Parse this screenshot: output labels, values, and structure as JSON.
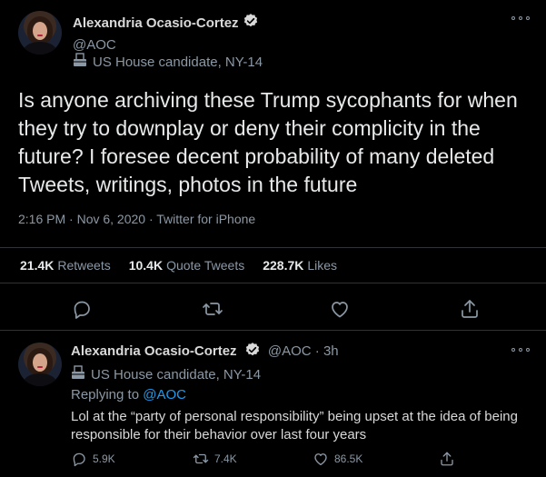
{
  "main": {
    "author_name": "Alexandria Ocasio-Cortez",
    "handle": "@AOC",
    "candidate_label": "US House candidate, NY-14",
    "text": "Is anyone archiving these Trump sycophants for when they try to downplay or deny their complicity in the future? I foresee decent probability of many deleted Tweets, writings, photos in the future",
    "meta": "2:16 PM · Nov 6, 2020 · Twitter for iPhone",
    "stats": {
      "retweets_count": "21.4K",
      "retweets_label": "Retweets",
      "quote_count": "10.4K",
      "quote_label": "Quote Tweets",
      "likes_count": "228.7K",
      "likes_label": "Likes"
    }
  },
  "reply": {
    "author_name": "Alexandria Ocasio-Cortez",
    "handle_time": "@AOC · 3h",
    "candidate_label": "US House candidate, NY-14",
    "replying_to_label": "Replying to",
    "replying_to_handle": "@AOC",
    "text": "Lol at the “party of personal responsibility” being upset at the idea of being responsible for their behavior over last four years",
    "replies_count": "5.9K",
    "retweets_count": "7.4K",
    "likes_count": "86.5K"
  },
  "icons": {
    "verified": "verified-badge-icon",
    "more": "more-options-icon",
    "candidate": "ballot-box-icon",
    "reply": "reply-icon",
    "retweet": "retweet-icon",
    "like": "heart-icon",
    "share": "share-icon"
  },
  "colors": {
    "background": "#000000",
    "text": "#d9d9d9",
    "secondary": "#8b98a5",
    "accent": "#1d9bf0",
    "divider": "#2f3336"
  }
}
